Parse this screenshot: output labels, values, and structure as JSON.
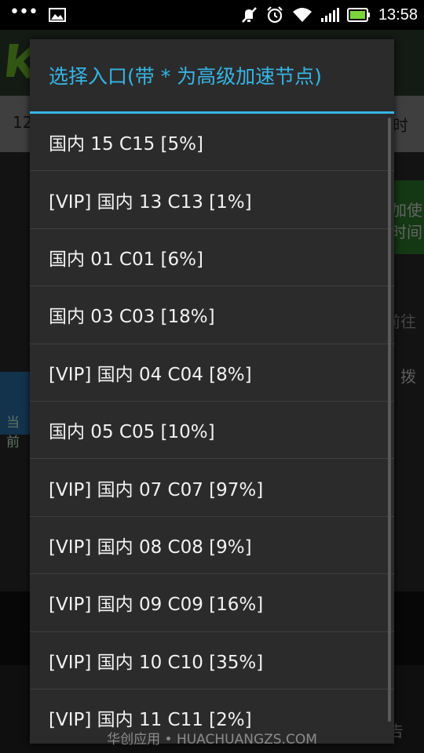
{
  "status_bar": {
    "time": "13:58",
    "icons": [
      "more-dots-icon",
      "image-notification-icon",
      "mute-icon",
      "alarm-icon",
      "wifi-icon",
      "signal-icon",
      "battery-icon"
    ]
  },
  "background": {
    "row_left": "12",
    "row_right": "时",
    "green_line1": "加使",
    "green_line2": "时间",
    "side_text1": "前往",
    "side_text2": "拨",
    "blue_text": "当前",
    "bottom_right": "告"
  },
  "dialog": {
    "title": "选择入口(带 * 为高级加速节点)",
    "items": [
      "国内 15 C15 [5%]",
      "[VIP] 国内 13 C13 [1%]",
      "国内 01 C01 [6%]",
      "国内 03 C03 [18%]",
      "[VIP] 国内 04 C04 [8%]",
      "国内 05 C05 [10%]",
      "[VIP] 国内 07 C07 [97%]",
      "[VIP] 国内 08 C08 [9%]",
      "[VIP] 国内 09 C09 [16%]",
      "[VIP] 国内 10 C10 [35%]",
      "[VIP] 国内 11 C11 [2%]"
    ]
  },
  "watermark": "华创应用 • HUACHUANGZS.COM",
  "colors": {
    "accent": "#35b5e5",
    "dialog_bg": "#2b2b2b",
    "divider": "#3f3f3f"
  }
}
